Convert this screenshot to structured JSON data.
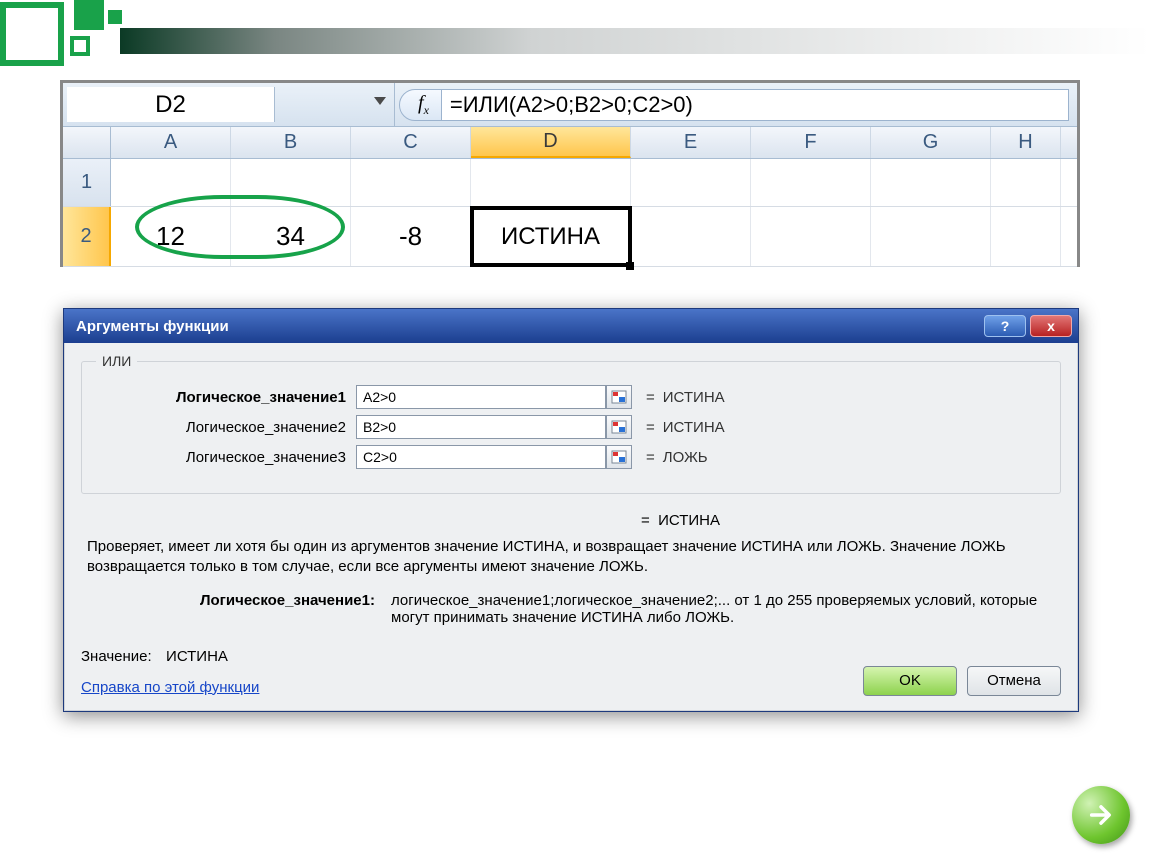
{
  "formula_bar": {
    "name_box": "D2",
    "fx_label": "f",
    "fx_sub": "x",
    "formula": "=ИЛИ(A2>0;B2>0;C2>0)"
  },
  "columns": [
    "A",
    "B",
    "C",
    "D",
    "E",
    "F",
    "G",
    "H"
  ],
  "active_column_index": 3,
  "rows": {
    "r1": {
      "label": "1"
    },
    "r2": {
      "label": "2",
      "A": "12",
      "B": "34",
      "C": "-8",
      "D": "ИСТИНА"
    }
  },
  "dialog": {
    "title": "Аргументы функции",
    "function_name": "ИЛИ",
    "args": [
      {
        "label": "Логическое_значение1",
        "value": "A2>0",
        "result": "ИСТИНА",
        "bold": true
      },
      {
        "label": "Логическое_значение2",
        "value": "B2>0",
        "result": "ИСТИНА",
        "bold": false
      },
      {
        "label": "Логическое_значение3",
        "value": "C2>0",
        "result": "ЛОЖЬ",
        "bold": false
      }
    ],
    "overall_eq": "=",
    "overall_result": "ИСТИНА",
    "description": "Проверяет, имеет ли хотя бы один из аргументов значение ИСТИНА, и возвращает значение ИСТИНА или ЛОЖЬ. Значение ЛОЖЬ возвращается только в том случае, если все аргументы имеют значение ЛОЖЬ.",
    "arg_desc_label": "Логическое_значение1:",
    "arg_desc_text": "логическое_значение1;логическое_значение2;... от 1 до 255 проверяемых условий, которые могут принимать значение ИСТИНА либо ЛОЖЬ.",
    "value_label": "Значение:",
    "value_result": "ИСТИНА",
    "help_link": "Справка по этой функции",
    "ok": "OK",
    "cancel": "Отмена",
    "help_btn": "?",
    "close_btn": "x"
  },
  "icons": {
    "eq": "="
  }
}
